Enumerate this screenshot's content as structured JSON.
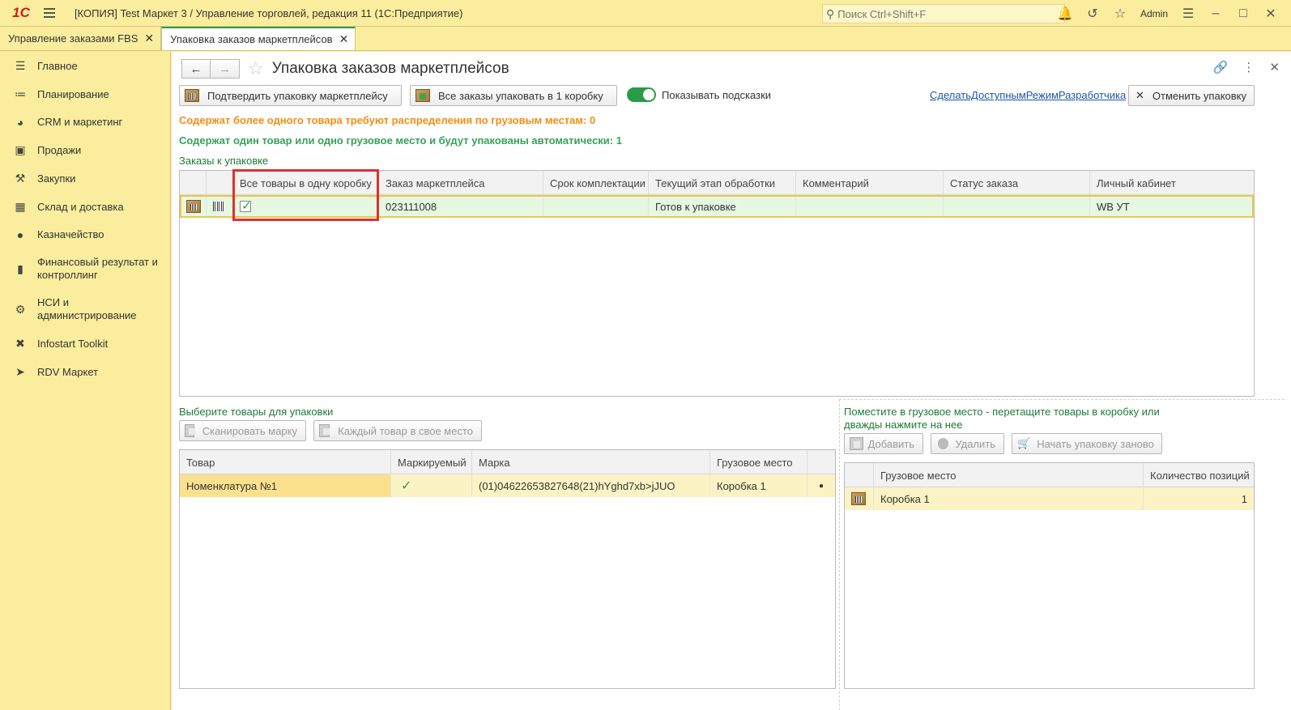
{
  "app": {
    "logo": "1С",
    "title": "[КОПИЯ] Test Маркет 3 / Управление торговлей, редакция 11  (1С:Предприятие)",
    "search_placeholder": "Поиск Ctrl+Shift+F",
    "user": "Admin"
  },
  "tabs": [
    {
      "label": "Управление заказами FBS"
    },
    {
      "label": "Упаковка заказов маркетплейсов"
    }
  ],
  "sidebar": {
    "items": [
      {
        "label": "Главное",
        "icon": "menu-list-icon"
      },
      {
        "label": "Планирование",
        "icon": "planning-chart-icon"
      },
      {
        "label": "CRM и маркетинг",
        "icon": "pie-chart-icon"
      },
      {
        "label": "Продажи",
        "icon": "shopping-bag-icon"
      },
      {
        "label": "Закупки",
        "icon": "shopping-cart-icon"
      },
      {
        "label": "Склад и доставка",
        "icon": "warehouse-grid-icon"
      },
      {
        "label": "Казначейство",
        "icon": "coins-icon"
      },
      {
        "label": "Финансовый результат и контроллинг",
        "icon": "bar-chart-icon"
      },
      {
        "label": "НСИ и администрирование",
        "icon": "gear-icon"
      },
      {
        "label": "Infostart Toolkit",
        "icon": "tools-icon"
      },
      {
        "label": "RDV Маркет",
        "icon": "rocket-icon"
      }
    ]
  },
  "page": {
    "title": "Упаковка заказов маркетплейсов",
    "buttons": {
      "confirm": "Подтвердить упаковку маркетплейсу",
      "all_one_box": "Все заказы упаковать в 1 коробку",
      "hints": "Показывать подсказки",
      "dev_mode": "СделатьДоступнымРежимРазработчика",
      "cancel_pack": "Отменить упаковку"
    },
    "info_orange": "Содержат более одного товара требуют распределения по грузовым местам: 0",
    "info_green": "Содержат один товар или одно грузовое место и будут упакованы автоматически: 1",
    "orders_label": "Заказы к упаковке",
    "select_label": "Выберите товары для упаковки",
    "place_label_1": "Поместите в грузовое место - перетащите товары в коробку или",
    "place_label_2": "дважды нажмите на нее",
    "scan_button": "Сканировать марку",
    "each_button": "Каждый товар в свое место",
    "add_button": "Добавить",
    "delete_button": "Удалить",
    "restart_button": "Начать упаковку заново"
  },
  "orders_table": {
    "columns": [
      "Все товары в одну коробку",
      "Заказ маркетплейса",
      "Срок комплектации",
      "Текущий этап обработки",
      "Комментарий",
      "Статус заказа",
      "Личный кабинет"
    ],
    "rows": [
      {
        "one_box": true,
        "order": "023111008",
        "term": "",
        "stage": "Готов к упаковке",
        "comment": "",
        "status": "",
        "cabinet": "WB УТ"
      }
    ]
  },
  "goods_table": {
    "columns": [
      "Товар",
      "Маркируемый",
      "Марка",
      "Грузовое место"
    ],
    "rows": [
      {
        "item": "Номенклатура №1",
        "marked": true,
        "mark": "(01)04622653827648(21)hYghd7xb>jJUO",
        "place": "Коробка 1"
      }
    ]
  },
  "places_table": {
    "columns": [
      "Грузовое место",
      "Количество позиций"
    ],
    "rows": [
      {
        "place": "Коробка 1",
        "count": "1"
      }
    ]
  },
  "colors": {
    "accent_green": "#2a9b48",
    "warning_orange": "#f28e13",
    "highlight_red": "#e03030",
    "panel_yellow": "#fbed9e"
  }
}
